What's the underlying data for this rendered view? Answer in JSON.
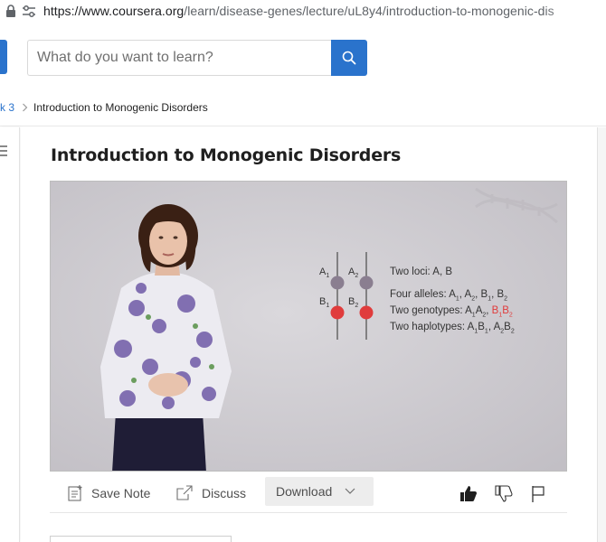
{
  "browser": {
    "url_host": "https://www.coursera.org",
    "url_path": "/learn/disease-genes/lecture/uL8y4/introduction-to-monogenic-dis"
  },
  "header": {
    "search_placeholder": "What do you want to learn?",
    "search_icon": "search-icon"
  },
  "breadcrumb": {
    "previous": "k 3",
    "current": "Introduction to Monogenic Disorders"
  },
  "lecture": {
    "title": "Introduction to Monogenic Disorders"
  },
  "slide": {
    "label_a1": "A",
    "label_a2": "A",
    "label_b1": "B",
    "label_b2": "B",
    "sub_1": "1",
    "sub_2": "2",
    "line_loci": "Two loci: A, B",
    "line_alleles_prefix": "Four alleles: ",
    "line_genotypes_prefix": "Two genotypes: ",
    "line_haplotypes_prefix": "Two haplotypes: ",
    "A": "A",
    "B": "B",
    "comma": ", "
  },
  "toolbar": {
    "save_note": "Save Note",
    "discuss": "Discuss",
    "download": "Download"
  },
  "colors": {
    "accent": "#2a73cc",
    "allele_gray": "#8a7e90",
    "allele_red": "#e03c3c"
  }
}
